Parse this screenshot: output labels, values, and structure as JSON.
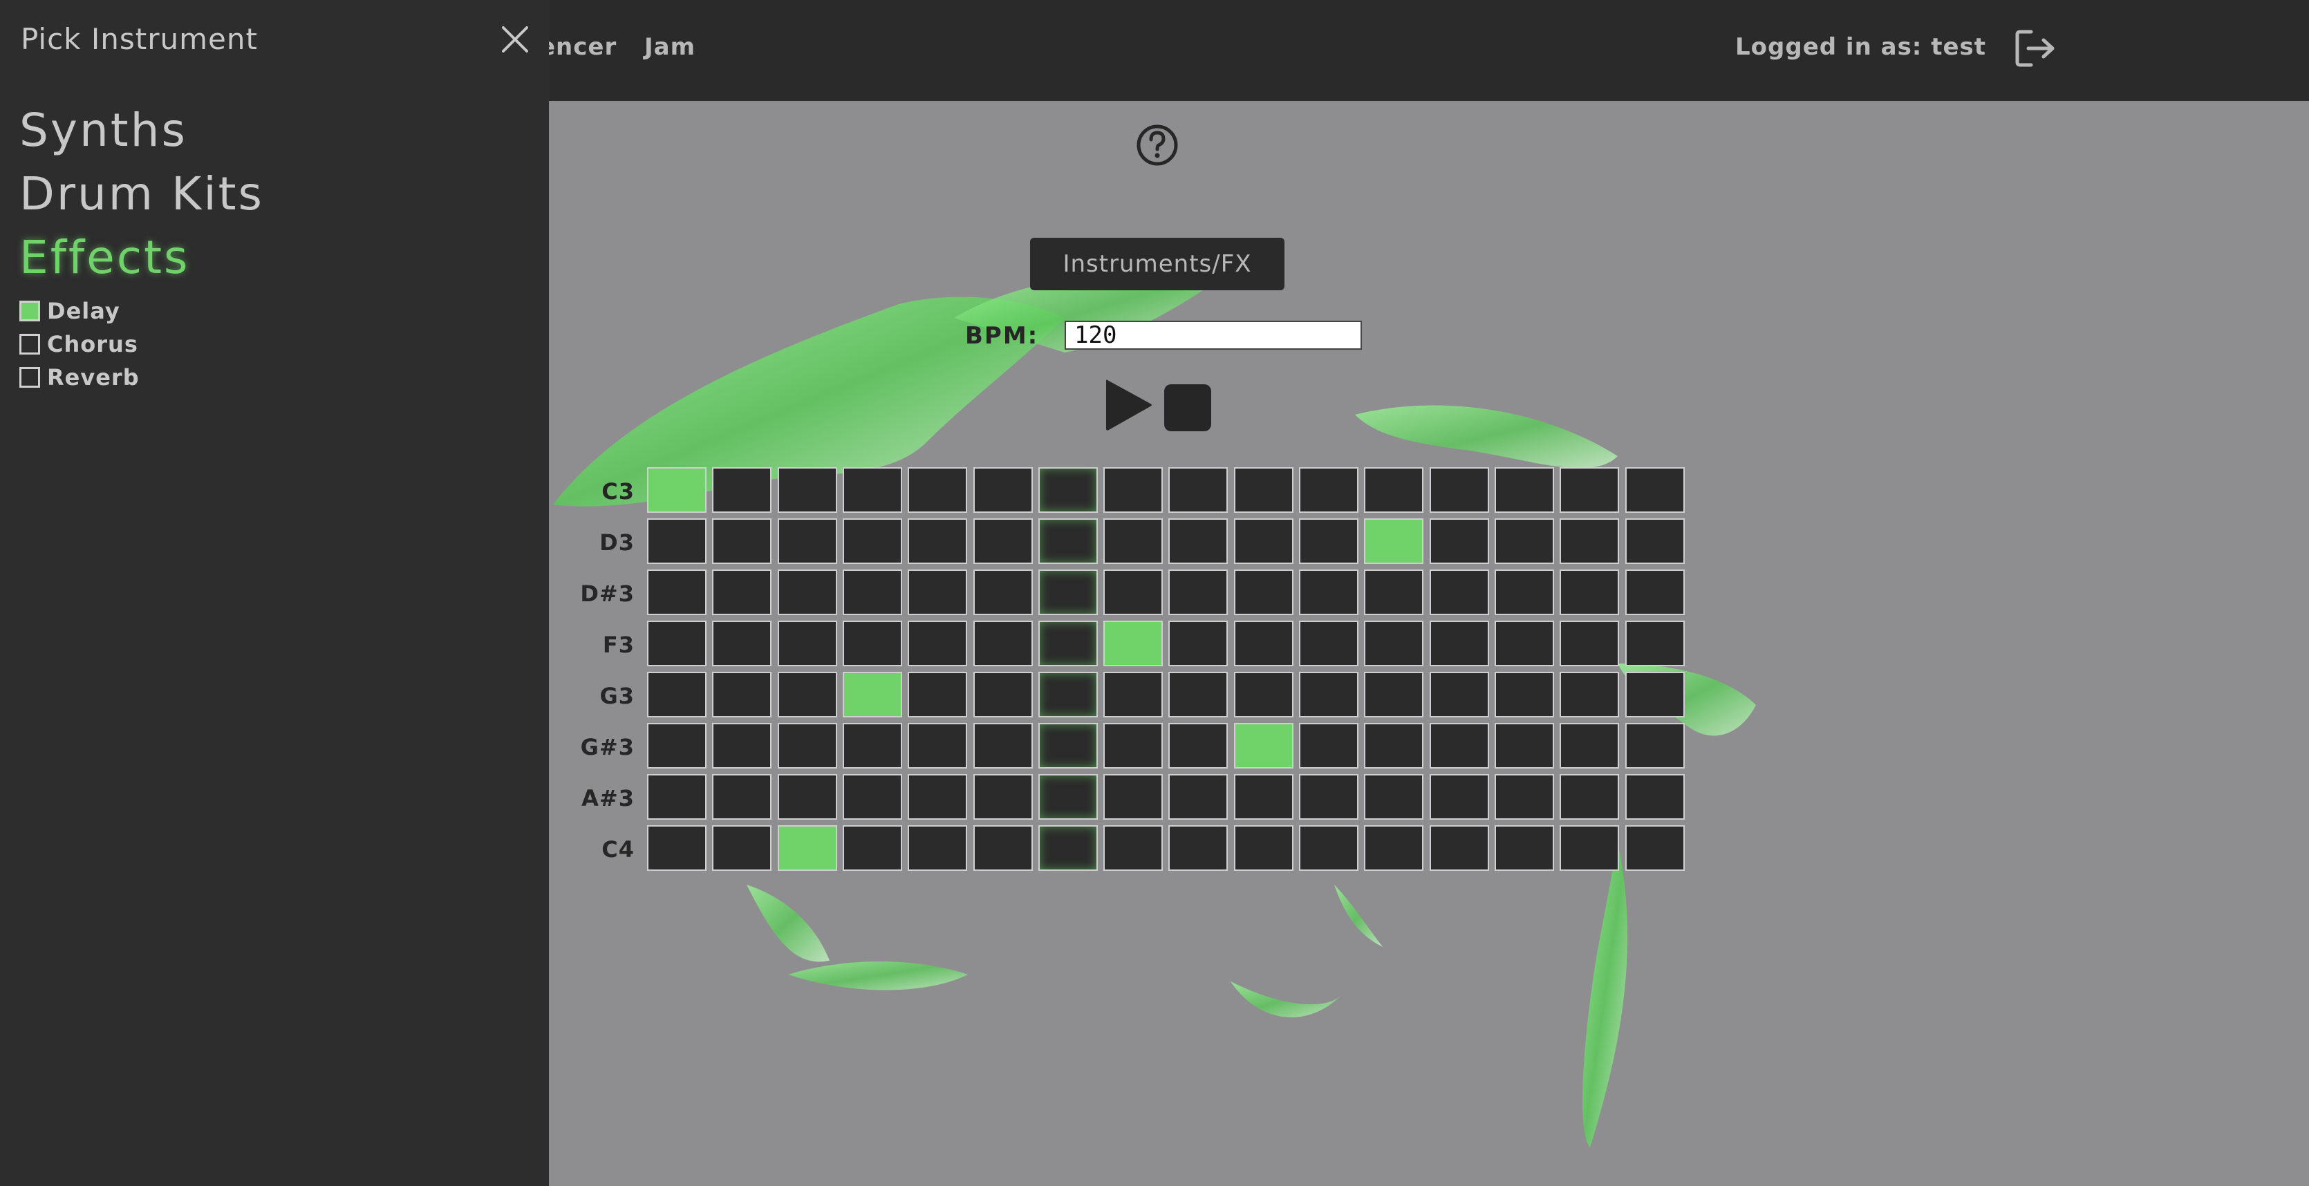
{
  "topbar": {
    "nav_partial": "encer",
    "nav_jam": "Jam",
    "logged_in": "Logged in as: test",
    "logout_icon": "logout-icon"
  },
  "sidebar": {
    "title": "Pick Instrument",
    "close_icon": "close-icon",
    "categories": [
      "Synths",
      "Drum Kits",
      "Effects"
    ],
    "active_category": "Effects",
    "effects": [
      {
        "label": "Delay",
        "checked": true
      },
      {
        "label": "Chorus",
        "checked": false
      },
      {
        "label": "Reverb",
        "checked": false
      }
    ]
  },
  "main": {
    "help_icon": "question-circle-icon",
    "instruments_button": "Instruments/FX",
    "bpm_label": "BPM:",
    "bpm_value": "120",
    "play_icon": "play-icon",
    "stop_icon": "stop-icon"
  },
  "sequencer": {
    "notes": [
      "C3",
      "D3",
      "D#3",
      "F3",
      "G3",
      "G#3",
      "A#3",
      "C4"
    ],
    "steps": 16,
    "playhead_step": 6,
    "active": [
      [
        0,
        0
      ],
      [
        1,
        11
      ],
      [
        3,
        7
      ],
      [
        4,
        3
      ],
      [
        5,
        9
      ],
      [
        7,
        2
      ]
    ]
  },
  "colors": {
    "accent": "#6fd36a",
    "panel": "#2d2d2d",
    "background": "#8e8e90"
  }
}
